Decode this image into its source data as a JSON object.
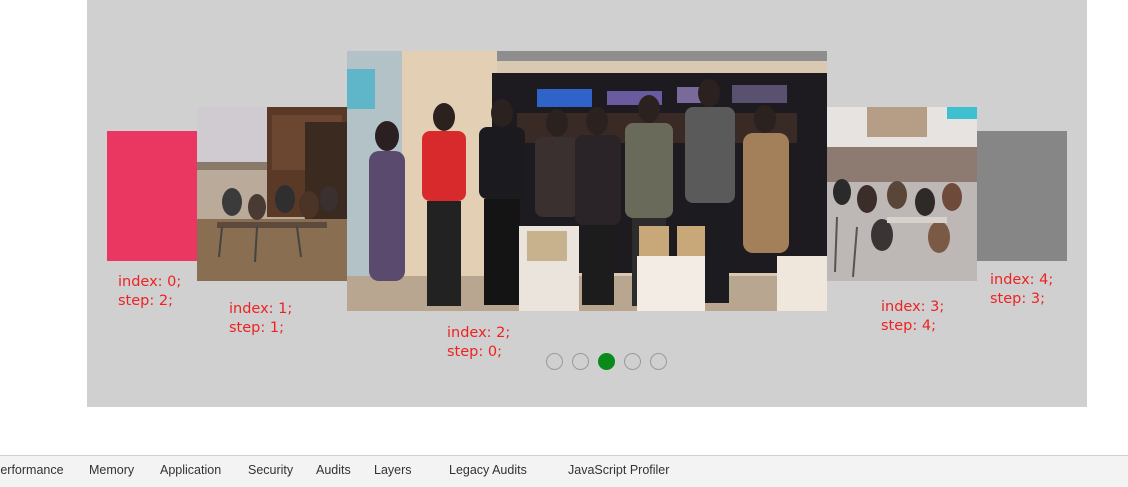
{
  "slides": [
    {
      "caption_index": "index: 0;",
      "caption_step": "step: 2;",
      "color": "#ea3762"
    },
    {
      "caption_index": "index: 1;",
      "caption_step": "step: 1;"
    },
    {
      "caption_index": "index: 2;",
      "caption_step": "step: 0;"
    },
    {
      "caption_index": "index: 3;",
      "caption_step": "step: 4;"
    },
    {
      "caption_index": "index: 4;",
      "caption_step": "step: 3;",
      "color": "#868686"
    }
  ],
  "pagination": {
    "count": 5,
    "active": 2,
    "active_color": "#0a8a1a"
  },
  "devtools_tabs": [
    "Performance",
    "Memory",
    "Application",
    "Security",
    "Audits",
    "Layers",
    "Legacy Audits",
    "JavaScript Profiler"
  ]
}
